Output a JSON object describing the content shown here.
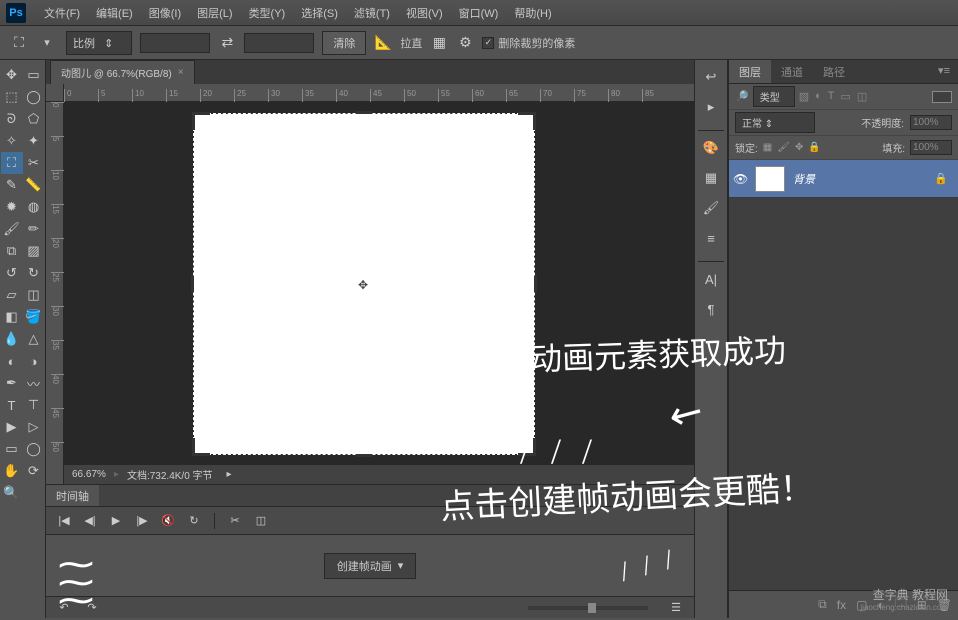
{
  "app": {
    "logo": "Ps"
  },
  "menu": {
    "file": "文件(F)",
    "edit": "编辑(E)",
    "image": "图像(I)",
    "layer": "图层(L)",
    "type": "类型(Y)",
    "select": "选择(S)",
    "filter": "滤镜(T)",
    "view": "视图(V)",
    "window": "窗口(W)",
    "help": "帮助(H)"
  },
  "options": {
    "ratio_mode": "比例",
    "clear": "清除",
    "straighten": "拉直",
    "delete_cropped": "删除裁剪的像素"
  },
  "document": {
    "tab_label": "动图儿 @ 66.7%(RGB/8)",
    "zoom": "66.67%",
    "doc_info": "文档:732.4K/0 字节"
  },
  "timeline": {
    "tab": "时间轴",
    "create_button": "创建帧动画"
  },
  "layers_panel": {
    "tabs": {
      "layers": "图层",
      "channels": "通道",
      "paths": "路径"
    },
    "kind_filter": "类型",
    "blend_mode": "正常",
    "opacity_label": "不透明度:",
    "opacity_value": "100%",
    "lock_label": "锁定:",
    "fill_label": "填充:",
    "fill_value": "100%",
    "bg_layer": "背景"
  },
  "annotations": {
    "line1": "动画元素获取成功",
    "line2": "点击创建帧动画会更酷！",
    "slashes": "/ / /"
  },
  "watermark": {
    "main": "查字典 教程网",
    "url": "jiaocheng.chazidian.com"
  },
  "ruler_h": [
    0,
    5,
    10,
    15,
    20,
    25,
    30,
    35,
    40,
    45,
    50,
    55,
    60,
    65,
    70,
    75,
    80,
    85
  ],
  "ruler_v": [
    0,
    5,
    10,
    15,
    20,
    25,
    30,
    35,
    40,
    45,
    50
  ]
}
